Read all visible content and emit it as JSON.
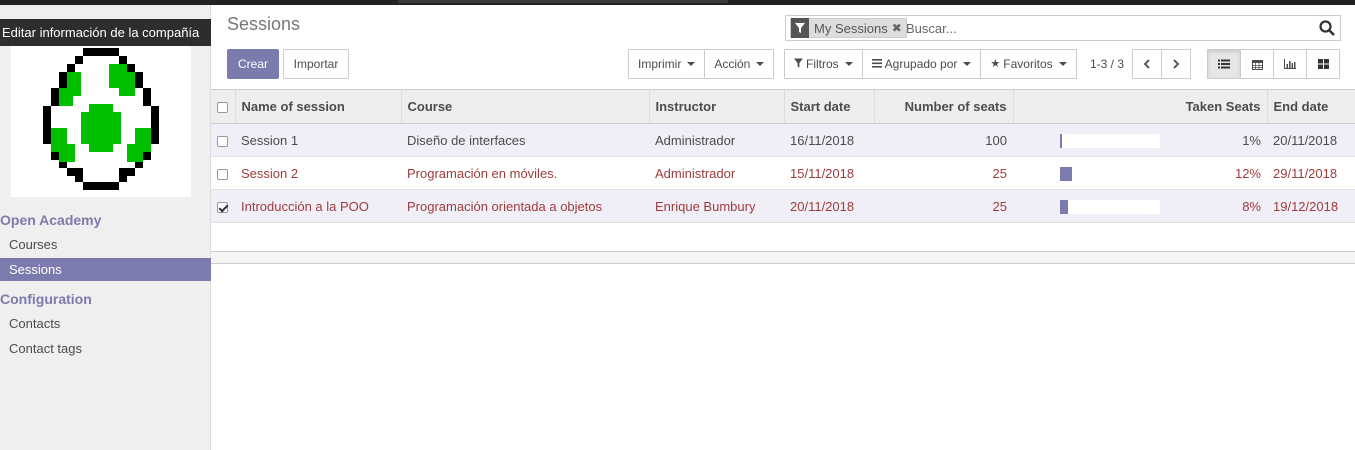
{
  "sidebar": {
    "company_label": "Editar información de la compañía",
    "sections": [
      {
        "title": "Open Academy",
        "items": [
          {
            "label": "Courses",
            "active": false
          },
          {
            "label": "Sessions",
            "active": true
          }
        ]
      },
      {
        "title": "Configuration",
        "items": [
          {
            "label": "Contacts",
            "active": false
          },
          {
            "label": "Contact tags",
            "active": false
          }
        ]
      }
    ]
  },
  "header": {
    "title": "Sessions"
  },
  "search": {
    "facet": "My Sessions",
    "placeholder": "Buscar..."
  },
  "buttons": {
    "create": "Crear",
    "import": "Importar",
    "print": "Imprimir",
    "action": "Acción",
    "filters": "Filtros",
    "group_by": "Agrupado por",
    "favorites": "Favoritos"
  },
  "pager": {
    "text": "1-3 / 3"
  },
  "colors": {
    "accent": "#7c7bad",
    "danger_text": "#9e3b3b",
    "logo_green": "#00c000"
  },
  "table": {
    "headers": [
      "Name of session",
      "Course",
      "Instructor",
      "Start date",
      "Number of seats",
      "Taken Seats",
      "End date"
    ],
    "rows": [
      {
        "name": "Session 1",
        "course": "Diseño de interfaces",
        "instructor": "Administrador",
        "start": "16/11/2018",
        "seats": "100",
        "taken_pct": 1,
        "taken": "1%",
        "end": "20/11/2018",
        "checked": false,
        "red": false
      },
      {
        "name": "Session 2",
        "course": "Programación en móviles.",
        "instructor": "Administrador",
        "start": "15/11/2018",
        "seats": "25",
        "taken_pct": 12,
        "taken": "12%",
        "end": "29/11/2018",
        "checked": false,
        "red": true
      },
      {
        "name": "Introducción a la POO",
        "course": "Programación orientada a objetos",
        "instructor": "Enrique Bumbury",
        "start": "20/11/2018",
        "seats": "25",
        "taken_pct": 8,
        "taken": "8%",
        "end": "19/12/2018",
        "checked": true,
        "red": true
      }
    ]
  }
}
